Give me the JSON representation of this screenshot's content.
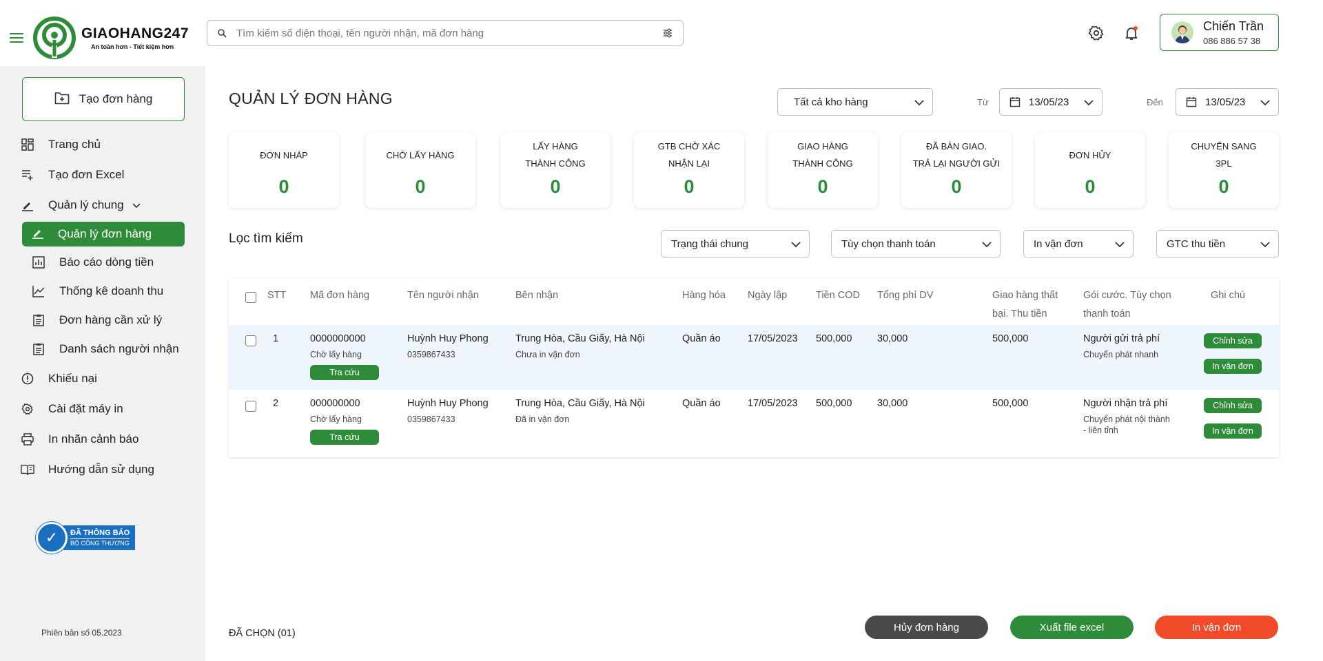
{
  "brand": {
    "name": "GIAOHANG247",
    "tagline": "An toàn hơn - Tiết kiệm hơn",
    "accent_color": "#2e8b3a"
  },
  "search": {
    "placeholder": "Tìm kiếm số điện thoại, tên người nhận, mã đơn hàng"
  },
  "user": {
    "name": "Chiến Trần",
    "phone": "086 886 57 38"
  },
  "sidebar": {
    "create_label": "Tạo đơn hàng",
    "items": [
      {
        "label": "Trang chủ",
        "icon": "dashboard-icon"
      },
      {
        "label": "Tạo đơn Excel",
        "icon": "playlist-add-icon"
      },
      {
        "label": "Quản lý chung",
        "icon": "edit-icon"
      },
      {
        "label": "Quản lý đơn hàng",
        "icon": "edit-icon"
      },
      {
        "label": "Báo cáo dòng tiền",
        "icon": "bar-chart-icon"
      },
      {
        "label": "Thống kê doanh thu",
        "icon": "line-chart-icon"
      },
      {
        "label": "Đơn hàng cần xử lý",
        "icon": "clipboard-icon"
      },
      {
        "label": "Danh sách người nhận",
        "icon": "clipboard-icon"
      },
      {
        "label": "Khiếu nại",
        "icon": "alert-icon"
      },
      {
        "label": "Cài đặt máy in",
        "icon": "gear-icon"
      },
      {
        "label": "In nhãn cảnh báo",
        "icon": "printer-icon"
      },
      {
        "label": "Hướng dẫn sử dụng",
        "icon": "book-icon"
      }
    ],
    "cert_line1": "ĐÃ THÔNG BÁO",
    "cert_line2": "BỘ CÔNG THƯƠNG",
    "version": "Phiên bản số 05.2023"
  },
  "main": {
    "title": "QUẢN LÝ ĐƠN HÀNG",
    "warehouse": "Tất cả kho hàng",
    "from_label": "Từ",
    "from_date": "13/05/23",
    "to_label": "Đến",
    "to_date": "13/05/23",
    "stats": [
      {
        "line1": "ĐƠN NHÁP",
        "line2": "",
        "value": "0"
      },
      {
        "line1": "CHỜ LẤY HÀNG",
        "line2": "",
        "value": "0"
      },
      {
        "line1": "LẤY HÀNG",
        "line2": "THÀNH CÔNG",
        "value": "0"
      },
      {
        "line1": "GTB CHỜ XÁC",
        "line2": "NHẬN LẠI",
        "value": "0"
      },
      {
        "line1": "GIAO HÀNG",
        "line2": "THÀNH CÔNG",
        "value": "0"
      },
      {
        "line1": "ĐÃ BÀN GIAO.",
        "line2": "TRẢ LẠI NGƯỜI GỬI",
        "value": "0"
      },
      {
        "line1": "ĐƠN HỦY",
        "line2": "",
        "value": "0"
      },
      {
        "line1": "CHUYỂN SANG",
        "line2": "3PL",
        "value": "0"
      }
    ],
    "filter_title": "Lọc tìm kiếm",
    "filters": [
      "Trạng thái chung",
      "Tùy chọn thanh toán",
      "In vận đơn",
      "GTC thu tiền"
    ]
  },
  "table": {
    "headers": {
      "stt": "STT",
      "code": "Mã đơn hàng",
      "recipient": "Tên người nhận",
      "receiver": "Bên nhận",
      "goods": "Hàng hóa",
      "date": "Ngày lập",
      "cod": "Tiền COD",
      "fee": "Tổng phí DV",
      "failed_1": "Giao hàng thất",
      "failed_2": "bại. Thu tiền",
      "package_1": "Gói cước. Tùy chọn",
      "package_2": "thanh toán",
      "note": "Ghi chú"
    },
    "rows": [
      {
        "stt": "1",
        "code": "0000000000",
        "status": "Chờ lấy hàng",
        "lookup": "Tra cứu",
        "name": "Huỳnh Huy Phong",
        "phone": "0359867433",
        "address": "Trung Hòa, Cầu Giấy, Hà Nội",
        "print_status": "Chưa in vận đơn",
        "goods": "Quần áo",
        "date": "17/05/2023",
        "cod": "500,000",
        "fee": "30,000",
        "failed": "500,000",
        "payer": "Người gửi trả phí",
        "service_1": "Chuyển phát nhanh",
        "service_2": "",
        "edit": "Chỉnh sửa",
        "print": "In vận đơn"
      },
      {
        "stt": "2",
        "code": "000000000",
        "status": "Chờ lấy hàng",
        "lookup": "Tra cứu",
        "name": "Huỳnh Huy Phong",
        "phone": "0359867433",
        "address": "Trung Hòa, Cầu Giấy, Hà Nội",
        "print_status": "Đã in vận đơn",
        "goods": "Quần áo",
        "date": "17/05/2023",
        "cod": "500,000",
        "fee": "30,000",
        "failed": "500,000",
        "payer": "Người nhận trả phí",
        "service_1": "Chuyển phát nội thành",
        "service_2": "- liên tỉnh",
        "edit": "Chỉnh sửa",
        "print": "In vận đơn"
      }
    ]
  },
  "footer": {
    "selected": "ĐÃ CHỌN (01)",
    "cancel": "Hủy đơn hàng",
    "export": "Xuất file excel",
    "print": "In vận đơn",
    "cancel_color": "#4a4a4a",
    "export_color": "#2e8b3a",
    "print_color": "#f04a2a"
  }
}
